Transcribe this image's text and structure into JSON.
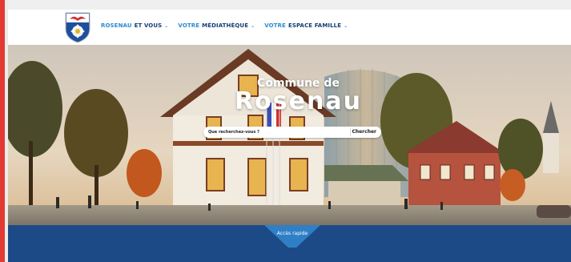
{
  "site": {
    "name": "Commune de Rosenau"
  },
  "nav": {
    "items": [
      {
        "part1": "ROSENAU",
        "part2": "ET VOUS"
      },
      {
        "part1": "VOTRE",
        "part2": "MÉDIATHÈQUE"
      },
      {
        "part1": "VOTRE",
        "part2": "ESPACE FAMILLE"
      }
    ]
  },
  "hero": {
    "title_line1": "Commune de",
    "title_line2": "Rosenau",
    "search_placeholder": "Que recherchez-vous ?",
    "search_button": "Chercher"
  },
  "footer": {
    "quick_access": "Accès rapide"
  },
  "colors": {
    "nav_accent": "#2a8bd0",
    "nav_dark": "#163e77",
    "footer_bg": "#1c4a86",
    "left_bar": "#e23a32"
  },
  "icons": [
    "coat-of-arms-logo",
    "chevron-down-icon"
  ]
}
